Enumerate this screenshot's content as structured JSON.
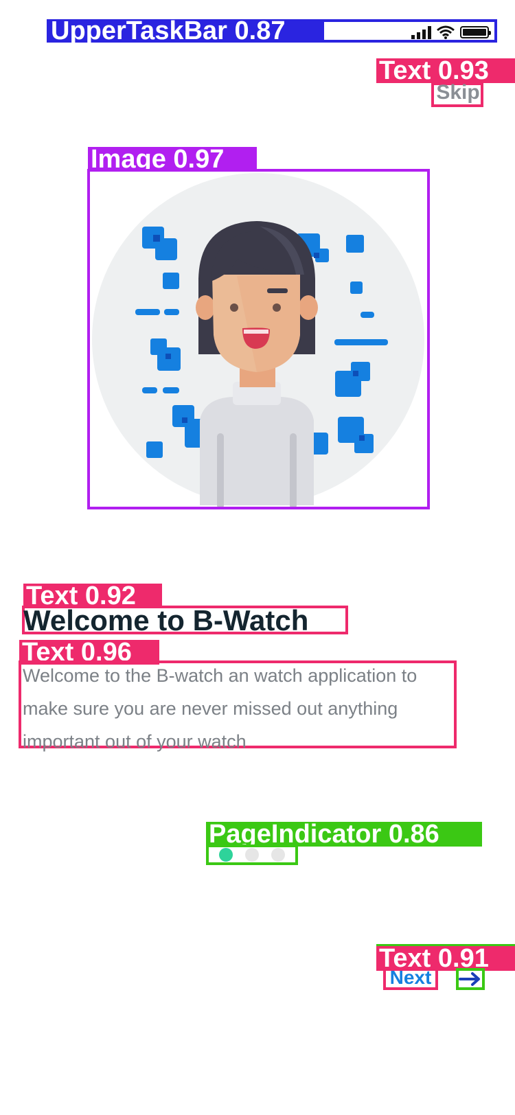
{
  "annotations": {
    "status_bar": "UpperTaskBar 0.87",
    "skip": "Text 0.93",
    "illustration": "Image 0.97",
    "title": "Text 0.92",
    "description": "Text 0.96",
    "page_indicator": "PageIndicator 0.86",
    "next": "Text 0.91"
  },
  "header": {
    "skip_label": "Skip"
  },
  "onboarding": {
    "title": "Welcome to B-Watch",
    "description": "Welcome to the B-watch an watch application to make sure you are never missed out anything important out of your watch"
  },
  "pager": {
    "total": 3,
    "active_index": 0
  },
  "footer": {
    "next_label": "Next"
  },
  "icons": {
    "status": [
      "signal-icon",
      "wifi-icon",
      "battery-icon"
    ],
    "next_arrow": "arrow-right-icon"
  },
  "colors": {
    "accent_blue": "#1580e0",
    "active_dot": "#2ed39a",
    "title_text": "#14252f",
    "body_text": "#7b8086"
  }
}
